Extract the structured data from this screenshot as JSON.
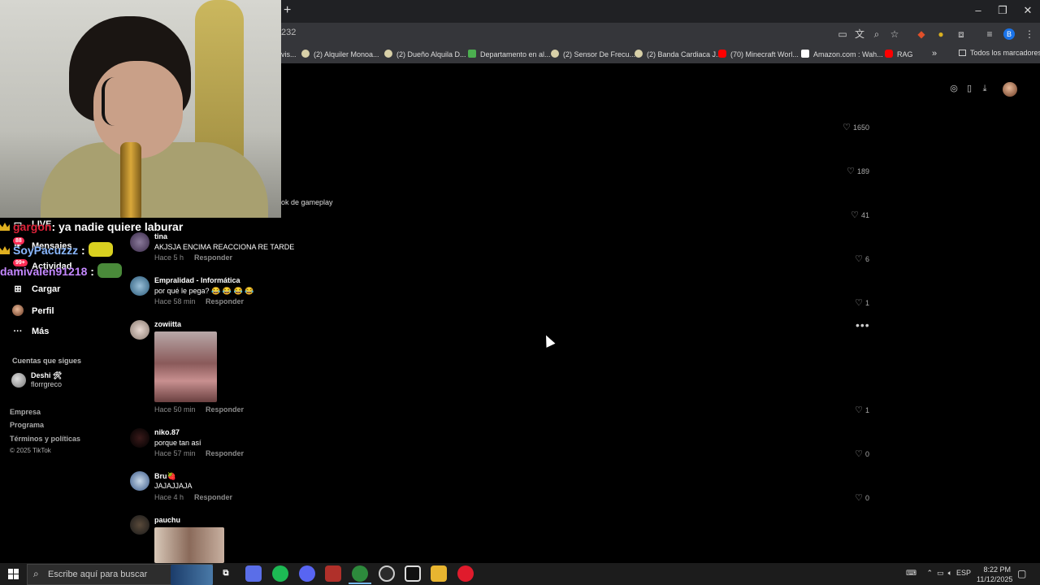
{
  "browser": {
    "new_tab": "+",
    "url_fragment": "232",
    "profile_initial": "B",
    "window_controls": [
      "–",
      "❐",
      "✕"
    ],
    "bookmarks": [
      {
        "label": "vis...",
        "icon": "generic"
      },
      {
        "label": "(2) Alquiler Monoa...",
        "icon": "generic"
      },
      {
        "label": "(2) Dueño Alquila D...",
        "icon": "generic"
      },
      {
        "label": "Departamento en al...",
        "icon": "dep"
      },
      {
        "label": "(2) Sensor De Frecu...",
        "icon": "generic"
      },
      {
        "label": "(2) Banda Cardiaca J...",
        "icon": "generic"
      },
      {
        "label": "(70) Minecraft Worl...",
        "icon": "yt"
      },
      {
        "label": "Amazon.com : Wah...",
        "icon": "amz"
      },
      {
        "label": "RAG",
        "icon": "yt"
      }
    ],
    "bookmarks_more": "»",
    "all_bookmarks": "Todos los marcadores"
  },
  "stream_chat": [
    {
      "user": "gargon",
      "user_color": "#e0233a",
      "message": ": ya nadie quiere laburar",
      "emote": null
    },
    {
      "user": "SoyPacuzzz",
      "user_color": "#8ab8ff",
      "message": ":",
      "emote": "#d9d020"
    },
    {
      "user": "damivalen91218",
      "user_color": "#c488ff",
      "message": ":",
      "emote": "#4a8a3a"
    }
  ],
  "sidebar": {
    "items": [
      {
        "label": "LIVE",
        "icon": "tv-icon"
      },
      {
        "label": "Mensajes",
        "icon": "message-icon",
        "badge": "88"
      },
      {
        "label": "Actividad",
        "icon": "bell-icon",
        "badge": "99+"
      },
      {
        "label": "Cargar",
        "icon": "plus-box-icon"
      },
      {
        "label": "Perfil",
        "icon": "profile-avatar"
      },
      {
        "label": "Más",
        "icon": "more-dots-icon"
      }
    ],
    "following_heading": "Cuentas que sigues",
    "following": [
      {
        "name": "Deshi 🛠",
        "username": "florrgreco"
      }
    ],
    "footer_links": [
      "Empresa",
      "Programa",
      "Términos y políticas"
    ],
    "copyright": "© 2025 TikTok"
  },
  "video_caption_fragment": "ok de gameplay",
  "comments": [
    {
      "user": "",
      "text": "",
      "time": "",
      "reply": "",
      "likes": "1650"
    },
    {
      "user": "",
      "text": "",
      "time": "",
      "reply": "",
      "likes": "189"
    },
    {
      "user": "",
      "text": "",
      "time": "",
      "reply": "",
      "likes": "41"
    },
    {
      "user": "tina",
      "text": "AKJSJA ENCIMA REACCIONA RE TARDE",
      "time": "Hace 5 h",
      "reply": "Responder",
      "likes": "6"
    },
    {
      "user": "Empralidad - Informática",
      "text": "por qué le pega? 😂 😂 😂 😂",
      "time": "Hace 58 min",
      "reply": "Responder",
      "likes": "1"
    },
    {
      "user": "zowiitta",
      "text": "",
      "time": "Hace 50 min",
      "reply": "Responder",
      "likes": "1"
    },
    {
      "user": "niko.87",
      "text": "porque tan así",
      "time": "Hace 57 min",
      "reply": "Responder",
      "likes": "0"
    },
    {
      "user": "Bru🍓",
      "text": "JAJAJJAJA",
      "time": "Hace 4 h",
      "reply": "Responder",
      "likes": "0"
    },
    {
      "user": "pauchu",
      "text": "",
      "time": "",
      "reply": "",
      "likes": ""
    }
  ],
  "comment_options": "•••",
  "taskbar": {
    "search_placeholder": "Escribe aquí para buscar",
    "apps": [
      {
        "name": "task-view",
        "glyph": "⧉",
        "color": "#1c1c1c"
      },
      {
        "name": "copilot",
        "glyph": "",
        "color": "#5a6ee8"
      },
      {
        "name": "spotify",
        "glyph": "",
        "color": "#1db954"
      },
      {
        "name": "discord",
        "glyph": "",
        "color": "#5865f2"
      },
      {
        "name": "voicemeeter",
        "glyph": "",
        "color": "#b0302a"
      },
      {
        "name": "chrome",
        "glyph": "",
        "color": "#2d8a3c"
      },
      {
        "name": "obs",
        "glyph": "",
        "color": "#2b2b2b"
      },
      {
        "name": "capcut",
        "glyph": "",
        "color": "#111111"
      },
      {
        "name": "file-explorer",
        "glyph": "",
        "color": "#e8b530"
      },
      {
        "name": "opera",
        "glyph": "",
        "color": "#e01b2c"
      }
    ],
    "language": "ESP",
    "time": "8:22 PM",
    "date": "11/12/2025"
  }
}
